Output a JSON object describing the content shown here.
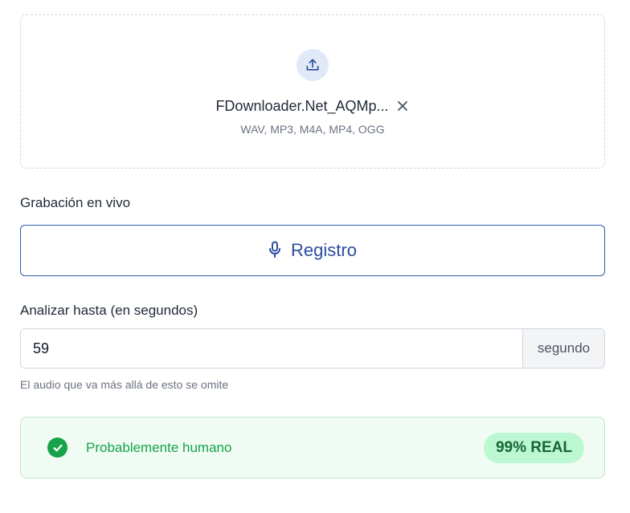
{
  "upload": {
    "icon": "upload-icon",
    "file_name": "FDownloader.Net_AQMp...",
    "remove_icon": "close-icon",
    "formats": "WAV, MP3, M4A, MP4, OGG"
  },
  "live_recording": {
    "label": "Grabación en vivo",
    "button_label": "Registro",
    "button_icon": "microphone-icon"
  },
  "analyze": {
    "label": "Analizar hasta (en segundos)",
    "value": "59",
    "unit": "segundo",
    "hint": "El audio que va más allá de esto se omite"
  },
  "result": {
    "icon": "check-circle-icon",
    "label": "Probablemente humano",
    "badge": "99% REAL"
  },
  "colors": {
    "accent_blue": "#2b4ea0",
    "success_green": "#16a34a",
    "badge_bg": "#bbf7d0"
  }
}
